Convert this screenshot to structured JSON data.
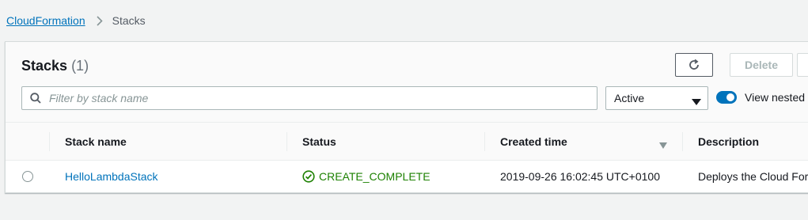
{
  "breadcrumb": {
    "root": "CloudFormation",
    "current": "Stacks"
  },
  "header": {
    "title": "Stacks",
    "count": "(1)"
  },
  "toolbar": {
    "delete_label": "Delete"
  },
  "search": {
    "placeholder": "Filter by stack name"
  },
  "filter": {
    "selected": "Active"
  },
  "toggle": {
    "label": "View nested",
    "on": true
  },
  "table": {
    "columns": [
      "Stack name",
      "Status",
      "Created time",
      "Description"
    ],
    "rows": [
      {
        "name": "HelloLambdaStack",
        "status": "CREATE_COMPLETE",
        "created": "2019-09-26 16:02:45 UTC+0100",
        "description": "Deploys the Cloud For"
      }
    ]
  },
  "colors": {
    "link": "#0073bb",
    "success": "#1d8102",
    "background": "#f2f3f3"
  },
  "icons": [
    "chevron-right-icon",
    "refresh-icon",
    "search-icon",
    "caret-down-icon",
    "sort-desc-icon",
    "check-circle-icon"
  ]
}
